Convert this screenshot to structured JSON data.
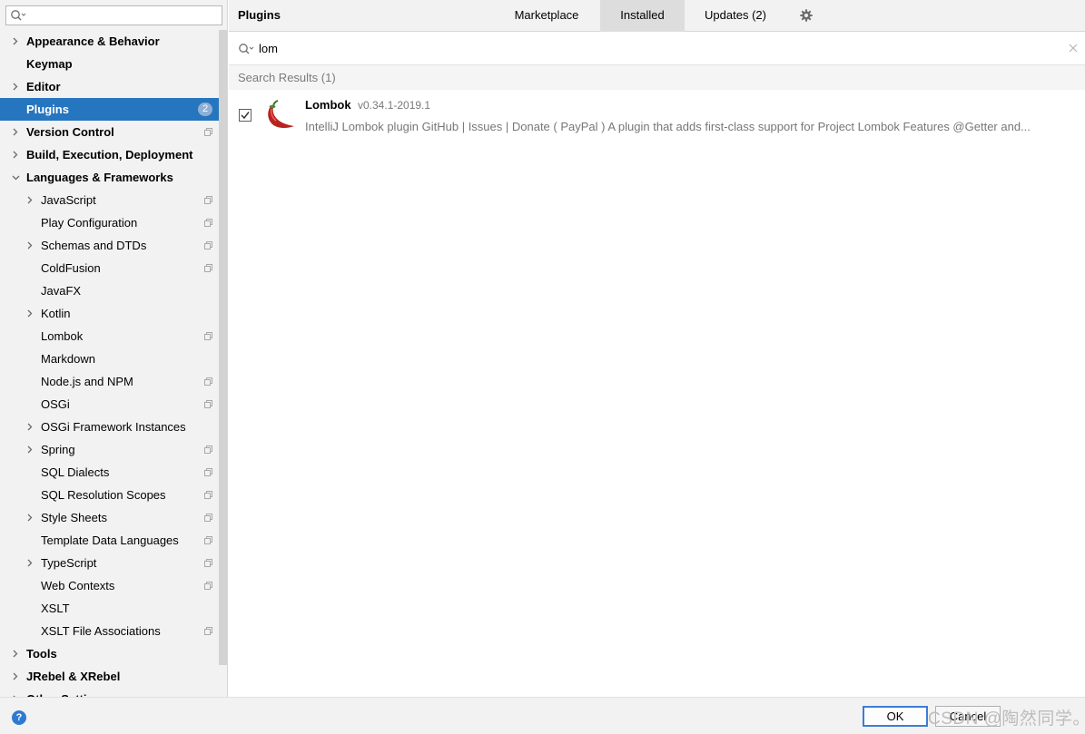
{
  "sidebar": {
    "search": {
      "value": "",
      "placeholder": ""
    },
    "items": [
      {
        "label": "Appearance & Behavior",
        "level": 0,
        "bold": true,
        "expandable": true,
        "expanded": false,
        "project_icon": false
      },
      {
        "label": "Keymap",
        "level": 0,
        "bold": true,
        "expandable": false,
        "project_icon": false
      },
      {
        "label": "Editor",
        "level": 0,
        "bold": true,
        "expandable": true,
        "expanded": false,
        "project_icon": false
      },
      {
        "label": "Plugins",
        "level": 0,
        "bold": true,
        "expandable": false,
        "selected": true,
        "badge": "2",
        "project_icon": false
      },
      {
        "label": "Version Control",
        "level": 0,
        "bold": true,
        "expandable": true,
        "expanded": false,
        "project_icon": true
      },
      {
        "label": "Build, Execution, Deployment",
        "level": 0,
        "bold": true,
        "expandable": true,
        "expanded": false,
        "project_icon": false
      },
      {
        "label": "Languages & Frameworks",
        "level": 0,
        "bold": true,
        "expandable": true,
        "expanded": true,
        "project_icon": false
      },
      {
        "label": "JavaScript",
        "level": 1,
        "expandable": true,
        "expanded": false,
        "project_icon": true
      },
      {
        "label": "Play Configuration",
        "level": 1,
        "expandable": false,
        "project_icon": true
      },
      {
        "label": "Schemas and DTDs",
        "level": 1,
        "expandable": true,
        "expanded": false,
        "project_icon": true
      },
      {
        "label": "ColdFusion",
        "level": 1,
        "expandable": false,
        "project_icon": true
      },
      {
        "label": "JavaFX",
        "level": 1,
        "expandable": false,
        "project_icon": false
      },
      {
        "label": "Kotlin",
        "level": 1,
        "expandable": true,
        "expanded": false,
        "project_icon": false
      },
      {
        "label": "Lombok",
        "level": 1,
        "expandable": false,
        "project_icon": true
      },
      {
        "label": "Markdown",
        "level": 1,
        "expandable": false,
        "project_icon": false
      },
      {
        "label": "Node.js and NPM",
        "level": 1,
        "expandable": false,
        "project_icon": true
      },
      {
        "label": "OSGi",
        "level": 1,
        "expandable": false,
        "project_icon": true
      },
      {
        "label": "OSGi Framework Instances",
        "level": 1,
        "expandable": true,
        "expanded": false,
        "project_icon": false
      },
      {
        "label": "Spring",
        "level": 1,
        "expandable": true,
        "expanded": false,
        "project_icon": true
      },
      {
        "label": "SQL Dialects",
        "level": 1,
        "expandable": false,
        "project_icon": true
      },
      {
        "label": "SQL Resolution Scopes",
        "level": 1,
        "expandable": false,
        "project_icon": true
      },
      {
        "label": "Style Sheets",
        "level": 1,
        "expandable": true,
        "expanded": false,
        "project_icon": true
      },
      {
        "label": "Template Data Languages",
        "level": 1,
        "expandable": false,
        "project_icon": true
      },
      {
        "label": "TypeScript",
        "level": 1,
        "expandable": true,
        "expanded": false,
        "project_icon": true
      },
      {
        "label": "Web Contexts",
        "level": 1,
        "expandable": false,
        "project_icon": true
      },
      {
        "label": "XSLT",
        "level": 1,
        "expandable": false,
        "project_icon": false
      },
      {
        "label": "XSLT File Associations",
        "level": 1,
        "expandable": false,
        "project_icon": true
      },
      {
        "label": "Tools",
        "level": 0,
        "bold": true,
        "expandable": true,
        "expanded": false,
        "project_icon": false
      },
      {
        "label": "JRebel & XRebel",
        "level": 0,
        "bold": true,
        "expandable": true,
        "expanded": false,
        "project_icon": false
      },
      {
        "label": "Other Settings",
        "level": 0,
        "bold": true,
        "expandable": true,
        "expanded": false,
        "project_icon": false
      }
    ]
  },
  "header": {
    "title": "Plugins",
    "tabs": [
      {
        "label": "Marketplace",
        "active": false
      },
      {
        "label": "Installed",
        "active": true
      },
      {
        "label": "Updates (2)",
        "active": false
      }
    ],
    "settings_icon": "gear-icon"
  },
  "plugin_search": {
    "query": "lom"
  },
  "results": {
    "header": "Search Results (1)",
    "plugins": [
      {
        "name": "Lombok",
        "version": "v0.34.1-2019.1",
        "description": "IntelliJ Lombok plugin GitHub | Issues | Donate ( PayPal ) A plugin that adds first-class support for Project Lombok Features @Getter and...",
        "enabled": true,
        "icon": "chili-pepper-icon"
      }
    ]
  },
  "footer": {
    "ok_label": "OK",
    "cancel_label": "Cancel",
    "watermark": "CSDN @陶然同学。"
  },
  "colors": {
    "selection": "#2675bf",
    "sidebar_bg": "#f2f2f2",
    "active_tab": "#dddddd",
    "default_button_border": "#3d7cd6",
    "help_icon": "#2f7ad1"
  }
}
